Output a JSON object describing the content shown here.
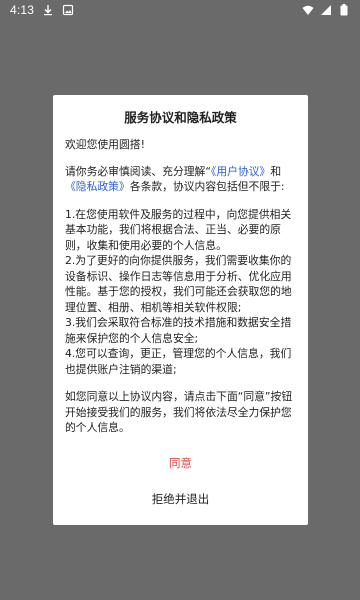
{
  "status_bar": {
    "time": "4:13",
    "icons_left": [
      "download-icon",
      "image-icon"
    ],
    "icons_right": [
      "wifi-icon",
      "signal-icon",
      "battery-icon"
    ]
  },
  "dialog": {
    "title": "服务协议和隐私政策",
    "welcome": "欢迎您使用圆搭!",
    "intro": {
      "part1": "请你务必审慎阅读、充分理解“",
      "link1": "《用户协议》",
      "part2": "和",
      "link2": "《隐私政策》",
      "part3": "各条款，协议内容包括但不限于:"
    },
    "item1": "1.在您使用软件及服务的过程中，向您提供相关基本功能，我们将根据合法、正当、必要的原则，收集和使用必要的个人信息。",
    "item2": "2.为了更好的向你提供服务，我们需要收集你的设备标识、操作日志等信息用于分析、优化应用性能。基于您的授权，我们可能还会获取您的地理位置、相册、相机等相关软件权限;",
    "item3": "3.我们会采取符合标准的技术措施和数据安全措施来保护您的个人信息安全;",
    "item4": "4.您可以查询，更正，管理您的个人信息，我们也提供账户注销的渠道;",
    "closing": "如您同意以上协议内容，请点击下面“同意”按钮开始接受我们的服务，我们将依法尽全力保护您的个人信息。",
    "agree_label": "同意",
    "reject_label": "拒绝并退出"
  },
  "colors": {
    "link": "#2f62c9",
    "agree": "#d9534f",
    "background": "#6a6a6a"
  }
}
